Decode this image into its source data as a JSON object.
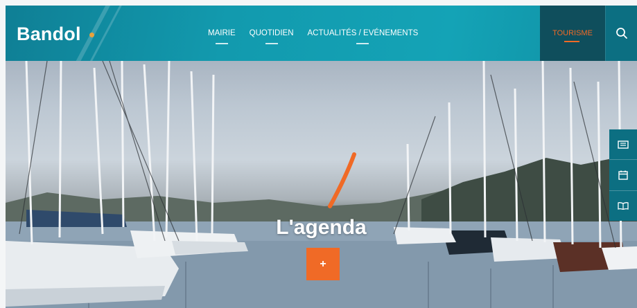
{
  "brand": {
    "logo_text": "Bandol",
    "accent_color": "#e9a23b"
  },
  "nav": {
    "items": [
      {
        "label": "MAIRIE"
      },
      {
        "label": "QUOTIDIEN"
      },
      {
        "label": "ACTUALITÉS / EVÉNEMENTS"
      }
    ],
    "tourisme_label": "TOURISME",
    "search_icon": "search-icon"
  },
  "hero": {
    "title": "L'agenda",
    "button_label": "+",
    "button_color": "#f06a26"
  },
  "side_buttons": [
    {
      "icon": "newspaper-icon"
    },
    {
      "icon": "calendar-icon"
    },
    {
      "icon": "book-icon"
    }
  ],
  "colors": {
    "header_teal": "#14a3b6",
    "tourisme_bg": "#0f4e5c",
    "orange": "#f06a26"
  }
}
